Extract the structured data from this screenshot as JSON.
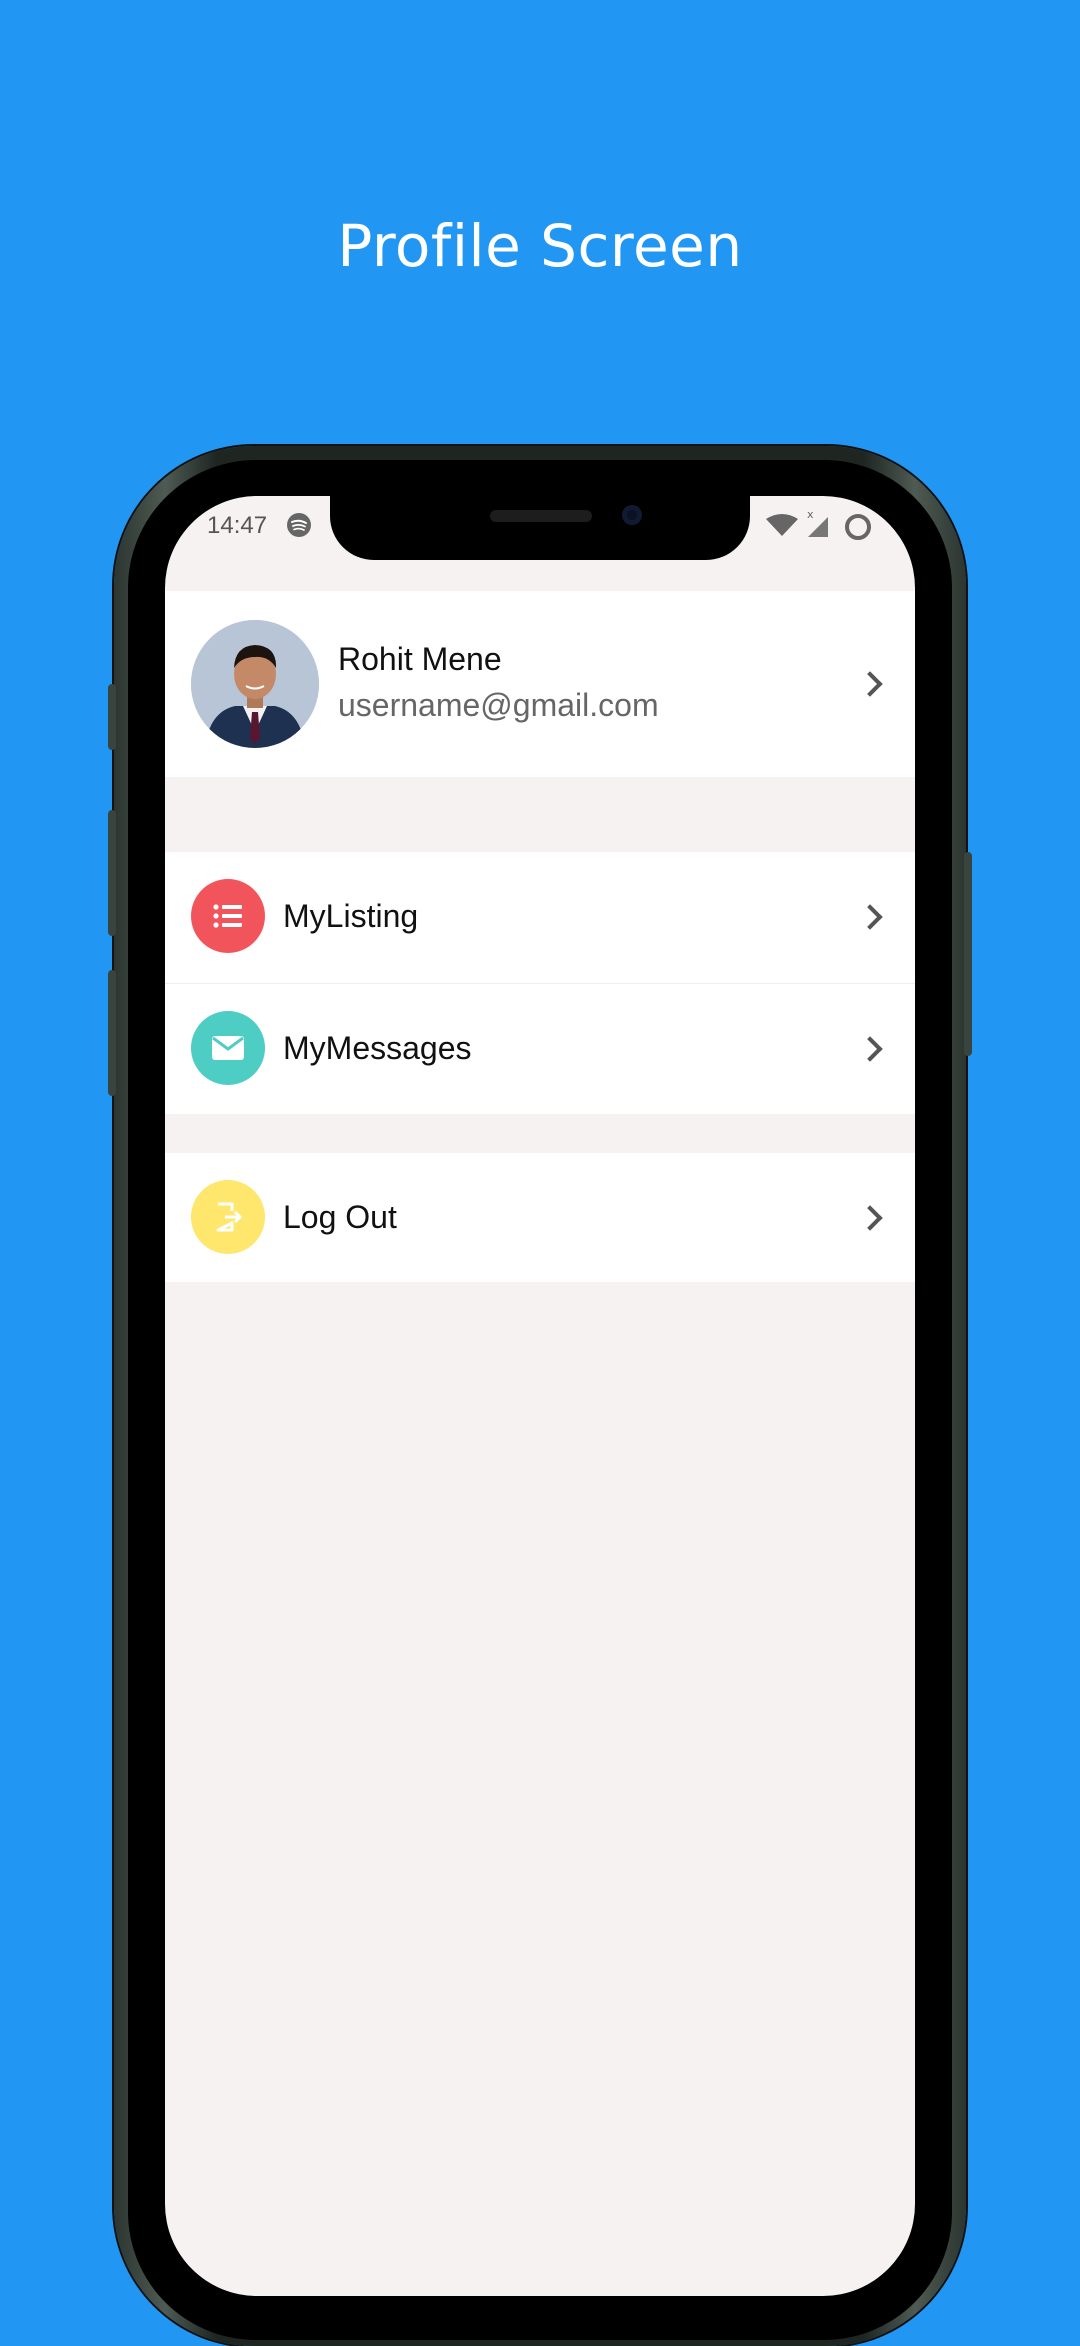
{
  "promo": {
    "title": "Profile Screen"
  },
  "status_bar": {
    "time": "14:47"
  },
  "profile": {
    "name": "Rohit Mene",
    "email": "username@gmail.com"
  },
  "menu": {
    "items": [
      {
        "label": "MyListing",
        "icon": "list-icon",
        "color": "#F2545B"
      },
      {
        "label": "MyMessages",
        "icon": "mail-icon",
        "color": "#4ECDC4"
      },
      {
        "label": "Log Out",
        "icon": "logout-icon",
        "color": "#FFE66D"
      }
    ]
  },
  "colors": {
    "background": "#2196F3",
    "screen": "#F5F2F1",
    "card": "#FFFFFF"
  }
}
